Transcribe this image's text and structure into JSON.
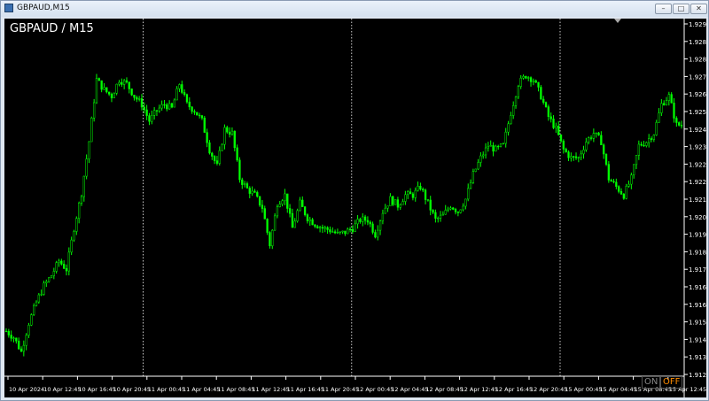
{
  "window": {
    "title": "GBPAUD,M15"
  },
  "chart": {
    "title": "GBPAUD / M15",
    "price_labels": [
      "1.92970",
      "1.92885",
      "1.92800",
      "1.92715",
      "1.92630",
      "1.92545",
      "1.92460",
      "1.92375",
      "1.92290",
      "1.92205",
      "1.92120",
      "1.92035",
      "1.91950",
      "1.91865",
      "1.91780",
      "1.91695",
      "1.91610",
      "1.91525",
      "1.91440",
      "1.91355",
      "1.91270"
    ],
    "time_labels": [
      "10 Apr 2024",
      "10 Apr 12:45",
      "10 Apr 16:45",
      "10 Apr 20:45",
      "11 Apr 00:45",
      "11 Apr 04:45",
      "11 Apr 08:45",
      "11 Apr 12:45",
      "11 Apr 16:45",
      "11 Apr 20:45",
      "12 Apr 00:45",
      "12 Apr 04:45",
      "12 Apr 08:45",
      "12 Apr 12:45",
      "12 Apr 16:45",
      "12 Apr 20:45",
      "15 Apr 00:45",
      "15 Apr 04:45",
      "15 Apr 08:45",
      "15 Apr 12:45"
    ],
    "on_label": "ON",
    "off_label": "OFF",
    "colors": {
      "background": "#000000",
      "candle": "#00ff00",
      "text": "#ffffff",
      "separator": "#ffffff",
      "off": "#ff8c00"
    }
  },
  "chart_data": {
    "type": "candlestick",
    "symbol": "GBPAUD",
    "timeframe": "M15",
    "ylim": [
      1.9127,
      1.93
    ],
    "day_separators_after_label": [
      "10 Apr 20:45",
      "11 Apr 20:45",
      "12 Apr 20:45"
    ],
    "close_path": [
      [
        0,
        1.9148
      ],
      [
        3,
        1.9145
      ],
      [
        6,
        1.9138
      ],
      [
        9,
        1.9152
      ],
      [
        12,
        1.9162
      ],
      [
        15,
        1.917
      ],
      [
        18,
        1.9175
      ],
      [
        21,
        1.9182
      ],
      [
        24,
        1.9178
      ],
      [
        27,
        1.9198
      ],
      [
        30,
        1.9215
      ],
      [
        33,
        1.924
      ],
      [
        36,
        1.927
      ],
      [
        39,
        1.9265
      ],
      [
        42,
        1.9262
      ],
      [
        45,
        1.927
      ],
      [
        48,
        1.9268
      ],
      [
        51,
        1.9262
      ],
      [
        54,
        1.9258
      ],
      [
        57,
        1.925
      ],
      [
        60,
        1.9255
      ],
      [
        63,
        1.9258
      ],
      [
        66,
        1.9256
      ],
      [
        69,
        1.9268
      ],
      [
        72,
        1.9258
      ],
      [
        75,
        1.9255
      ],
      [
        78,
        1.925
      ],
      [
        81,
        1.9236
      ],
      [
        84,
        1.9228
      ],
      [
        87,
        1.9246
      ],
      [
        90,
        1.9244
      ],
      [
        93,
        1.9222
      ],
      [
        96,
        1.9217
      ],
      [
        99,
        1.9214
      ],
      [
        102,
        1.9208
      ],
      [
        105,
        1.919
      ],
      [
        108,
        1.921
      ],
      [
        111,
        1.9214
      ],
      [
        114,
        1.9198
      ],
      [
        117,
        1.921
      ],
      [
        120,
        1.9203
      ],
      [
        123,
        1.92
      ],
      [
        126,
        1.9198
      ],
      [
        129,
        1.9197
      ],
      [
        132,
        1.9195
      ],
      [
        135,
        1.9196
      ],
      [
        138,
        1.9198
      ],
      [
        141,
        1.9202
      ],
      [
        144,
        1.9202
      ],
      [
        147,
        1.9195
      ],
      [
        150,
        1.9206
      ],
      [
        153,
        1.9212
      ],
      [
        156,
        1.9209
      ],
      [
        159,
        1.9214
      ],
      [
        162,
        1.9214
      ],
      [
        165,
        1.9218
      ],
      [
        168,
        1.921
      ],
      [
        171,
        1.9202
      ],
      [
        174,
        1.9204
      ],
      [
        177,
        1.9209
      ],
      [
        180,
        1.9206
      ],
      [
        183,
        1.9212
      ],
      [
        186,
        1.9224
      ],
      [
        189,
        1.9232
      ],
      [
        192,
        1.9238
      ],
      [
        195,
        1.9236
      ],
      [
        198,
        1.9238
      ],
      [
        201,
        1.9254
      ],
      [
        204,
        1.9268
      ],
      [
        207,
        1.9272
      ],
      [
        210,
        1.927
      ],
      [
        213,
        1.9262
      ],
      [
        216,
        1.9252
      ],
      [
        219,
        1.9246
      ],
      [
        222,
        1.9236
      ],
      [
        225,
        1.9232
      ],
      [
        228,
        1.9232
      ],
      [
        231,
        1.924
      ],
      [
        234,
        1.9244
      ],
      [
        237,
        1.924
      ],
      [
        240,
        1.9222
      ],
      [
        243,
        1.9218
      ],
      [
        246,
        1.9214
      ],
      [
        249,
        1.9222
      ],
      [
        252,
        1.9238
      ],
      [
        255,
        1.924
      ],
      [
        258,
        1.9244
      ],
      [
        261,
        1.9258
      ],
      [
        264,
        1.9262
      ],
      [
        267,
        1.9248
      ]
    ]
  }
}
